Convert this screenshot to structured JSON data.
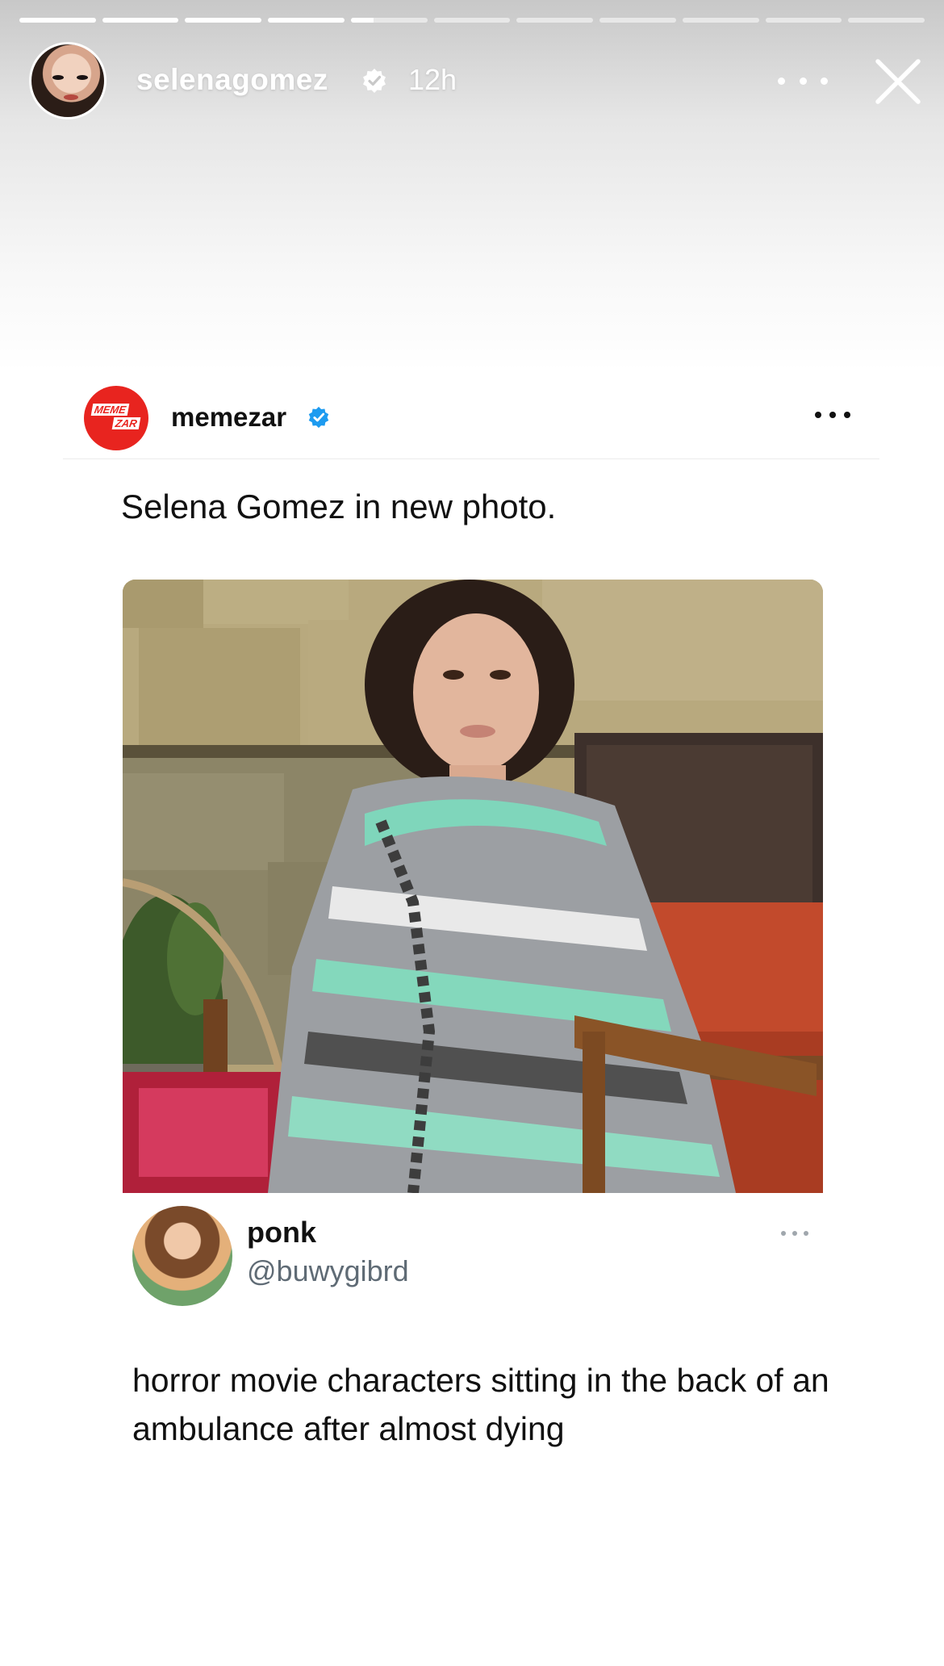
{
  "story": {
    "progress_segments": [
      1,
      1,
      1,
      1,
      0.3,
      0,
      0,
      0,
      0,
      0,
      0
    ],
    "username": "selenagomez",
    "verified_icon": "verified-badge-icon",
    "time_ago": "12h",
    "more_icon": "more-horizontal-icon",
    "close_icon": "close-icon"
  },
  "post": {
    "author": "memezar",
    "logo_line1": "MEME",
    "logo_line2": "ZAR",
    "verified_color": "#1d9bf0",
    "caption": "Selena Gomez in new photo."
  },
  "tweet": {
    "name": "ponk",
    "handle": "@buwygibrd",
    "text": "horror movie characters sitting in the back of an ambulance after almost dying"
  },
  "colors": {
    "memezar_red": "#e8241f",
    "handle_gray": "#5f6b75"
  }
}
